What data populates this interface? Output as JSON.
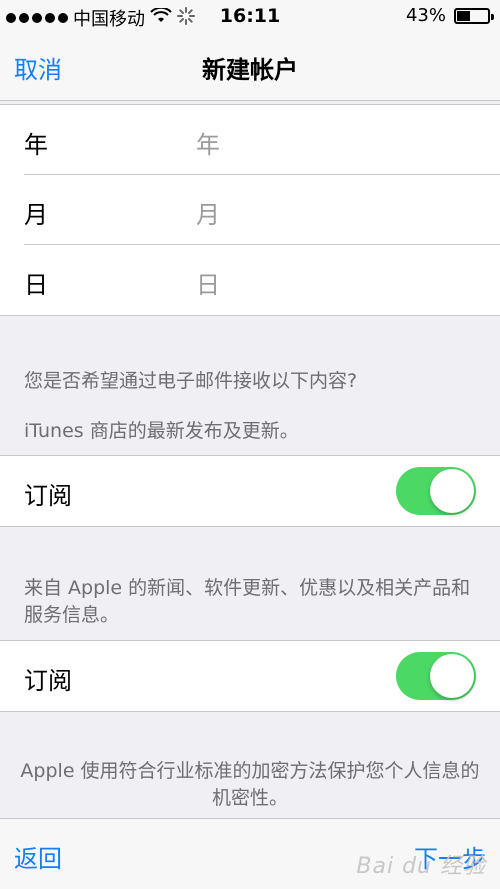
{
  "status_bar": {
    "carrier": "中国移动",
    "time": "16:11",
    "battery": "43%",
    "battery_level": 0.43,
    "icons": [
      "signal-dots-icon",
      "wifi-icon",
      "loading-spinner-icon",
      "battery-icon"
    ]
  },
  "nav": {
    "cancel_label": "取消",
    "title": "新建帐户"
  },
  "date_fields": [
    {
      "label": "年",
      "placeholder": "年"
    },
    {
      "label": "月",
      "placeholder": "月"
    },
    {
      "label": "日",
      "placeholder": "日"
    }
  ],
  "email_question": "您是否希望通过电子邮件接收以下内容?",
  "itunes_note": "iTunes 商店的最新发布及更新。",
  "subscription_1": {
    "label": "订阅",
    "on": true
  },
  "apple_note": "来自 Apple 的新闻、软件更新、优惠以及相关产品和服务信息。",
  "subscription_2": {
    "label": "订阅",
    "on": true
  },
  "privacy_note": "Apple 使用符合行业标准的加密方法保护您个人信息的机密性。",
  "toolbar": {
    "back_label": "返回",
    "next_label": "下一步"
  },
  "watermark": "Bai du 经验",
  "colors": {
    "accent": "#157efb",
    "toggle_on": "#4cd864"
  }
}
